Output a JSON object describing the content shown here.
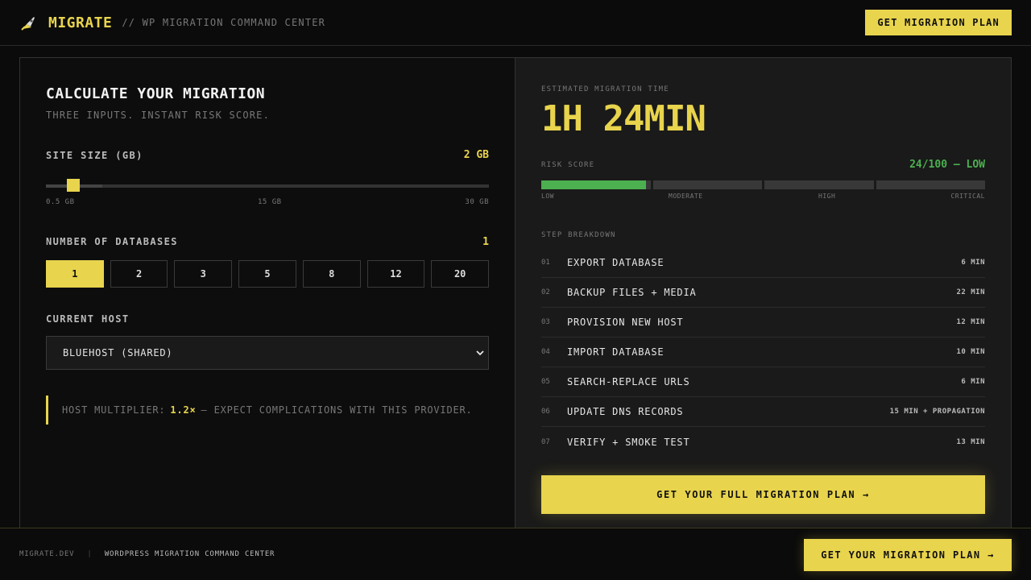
{
  "header": {
    "brand": "MIGRATE",
    "tagline": "// WP MIGRATION COMMAND CENTER",
    "cta_label": "GET MIGRATION PLAN",
    "logo_icon": "rocket-icon"
  },
  "calculator": {
    "title": "CALCULATE YOUR MIGRATION",
    "subtitle": "THREE INPUTS. INSTANT RISK SCORE.",
    "site_size": {
      "label": "SITE SIZE (GB)",
      "value": "2 GB",
      "current_gb": 2,
      "min_label": "0.5 GB",
      "mid_label": "15 GB",
      "max_label": "30 GB"
    },
    "databases": {
      "label": "NUMBER OF DATABASES",
      "value": "1",
      "options": [
        "1",
        "2",
        "3",
        "5",
        "8",
        "12",
        "20"
      ],
      "selected": "1"
    },
    "host": {
      "label": "CURRENT HOST",
      "selected": "BLUEHOST (SHARED)"
    },
    "note": {
      "prefix": "HOST MULTIPLIER:",
      "multiplier": "1.2×",
      "suffix": "— EXPECT COMPLICATIONS WITH THIS PROVIDER."
    }
  },
  "results": {
    "estimate_label": "ESTIMATED MIGRATION TIME",
    "estimate_value": "1H 24MIN",
    "risk": {
      "label": "RISK SCORE",
      "value": "24/100 — LOW",
      "score": 24,
      "levels": [
        "LOW",
        "MODERATE",
        "HIGH",
        "CRITICAL"
      ]
    },
    "steps_label": "STEP BREAKDOWN",
    "steps": [
      {
        "num": "01",
        "name": "EXPORT DATABASE",
        "time": "6 MIN"
      },
      {
        "num": "02",
        "name": "BACKUP FILES + MEDIA",
        "time": "22 MIN"
      },
      {
        "num": "03",
        "name": "PROVISION NEW HOST",
        "time": "12 MIN"
      },
      {
        "num": "04",
        "name": "IMPORT DATABASE",
        "time": "10 MIN"
      },
      {
        "num": "05",
        "name": "SEARCH-REPLACE URLS",
        "time": "6 MIN"
      },
      {
        "num": "06",
        "name": "UPDATE DNS RECORDS",
        "time": "15 MIN + PROPAGATION"
      },
      {
        "num": "07",
        "name": "VERIFY + SMOKE TEST",
        "time": "13 MIN"
      }
    ],
    "cta_label": "GET YOUR FULL MIGRATION PLAN →"
  },
  "footer": {
    "domain": "MIGRATE.DEV",
    "separator": "|",
    "title": "WORDPRESS MIGRATION COMMAND CENTER",
    "cta_label": "GET YOUR MIGRATION PLAN →"
  },
  "colors": {
    "accent": "#e8d44d",
    "risk_low": "#4caf50",
    "background": "#0b0b0b",
    "panel": "#1a1a1a"
  }
}
